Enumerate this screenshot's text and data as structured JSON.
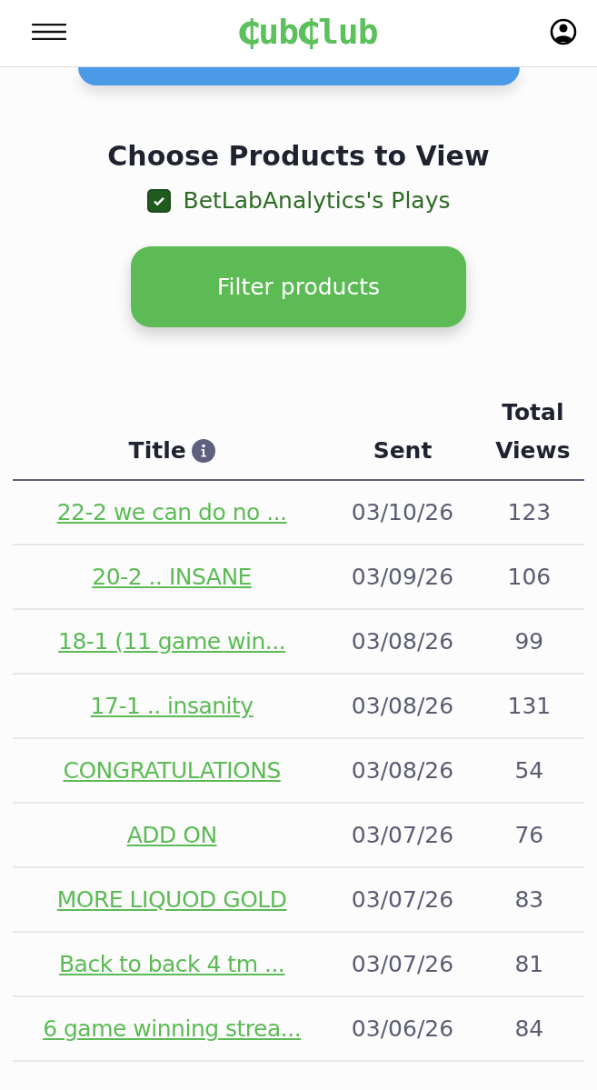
{
  "header": {
    "logo": "₵ub₵lub"
  },
  "heading": "Choose Products to View",
  "filters": [
    {
      "label": "BetLabAnalytics's Plays",
      "checked": true
    }
  ],
  "filter_button": "Filter products",
  "table": {
    "columns": [
      {
        "label": "Title",
        "info": true
      },
      {
        "label": "Sent",
        "info": false
      },
      {
        "label": "Total Views",
        "info": false
      }
    ],
    "rows": [
      {
        "title": "22-2 we can do no ...",
        "sent": "03/10/26",
        "views": "123"
      },
      {
        "title": "20-2 .. INSANE",
        "sent": "03/09/26",
        "views": "106"
      },
      {
        "title": "18-1 (11 game win...",
        "sent": "03/08/26",
        "views": "99"
      },
      {
        "title": "17-1 .. insanity",
        "sent": "03/08/26",
        "views": "131"
      },
      {
        "title": "CONGRATULATIONS",
        "sent": "03/08/26",
        "views": "54"
      },
      {
        "title": "ADD ON",
        "sent": "03/07/26",
        "views": "76"
      },
      {
        "title": "MORE LIQUOD GOLD",
        "sent": "03/07/26",
        "views": "83"
      },
      {
        "title": "Back to back 4 tm ...",
        "sent": "03/07/26",
        "views": "81"
      },
      {
        "title": "6 game winning strea...",
        "sent": "03/06/26",
        "views": "84"
      }
    ]
  }
}
